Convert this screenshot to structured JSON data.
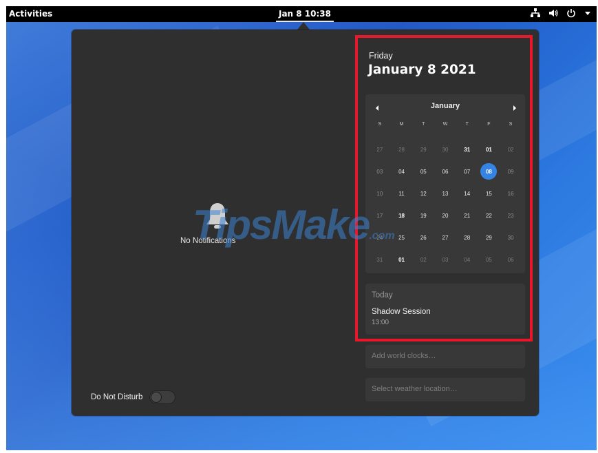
{
  "topbar": {
    "activities_label": "Activities",
    "clock_label": "Jan 8  10:38",
    "tray_icons": [
      "network-icon",
      "volume-icon",
      "power-icon",
      "menu-arrow-icon"
    ]
  },
  "notifications": {
    "empty_label": "No Notifications",
    "dnd_label": "Do Not Disturb",
    "dnd_enabled": false
  },
  "date": {
    "weekday": "Friday",
    "full_date": "January 8 2021"
  },
  "calendar": {
    "month_label": "January",
    "weekday_headers": [
      "S",
      "M",
      "T",
      "W",
      "T",
      "F",
      "S"
    ],
    "selected_day": "08",
    "weeks": [
      [
        {
          "d": "27",
          "c": "other"
        },
        {
          "d": "28",
          "c": "other"
        },
        {
          "d": "29",
          "c": "other"
        },
        {
          "d": "30",
          "c": "other"
        },
        {
          "d": "31",
          "c": "bold"
        },
        {
          "d": "01",
          "c": "bold"
        },
        {
          "d": "02",
          "c": "other"
        }
      ],
      [
        {
          "d": "03",
          "c": "weekend"
        },
        {
          "d": "04",
          "c": ""
        },
        {
          "d": "05",
          "c": ""
        },
        {
          "d": "06",
          "c": ""
        },
        {
          "d": "07",
          "c": ""
        },
        {
          "d": "08",
          "c": "selected"
        },
        {
          "d": "09",
          "c": "weekend"
        }
      ],
      [
        {
          "d": "10",
          "c": "weekend"
        },
        {
          "d": "11",
          "c": ""
        },
        {
          "d": "12",
          "c": ""
        },
        {
          "d": "13",
          "c": ""
        },
        {
          "d": "14",
          "c": ""
        },
        {
          "d": "15",
          "c": ""
        },
        {
          "d": "16",
          "c": "weekend"
        }
      ],
      [
        {
          "d": "17",
          "c": "weekend"
        },
        {
          "d": "18",
          "c": "bold"
        },
        {
          "d": "19",
          "c": ""
        },
        {
          "d": "20",
          "c": ""
        },
        {
          "d": "21",
          "c": ""
        },
        {
          "d": "22",
          "c": ""
        },
        {
          "d": "23",
          "c": "weekend"
        }
      ],
      [
        {
          "d": "24",
          "c": "weekend"
        },
        {
          "d": "25",
          "c": ""
        },
        {
          "d": "26",
          "c": ""
        },
        {
          "d": "27",
          "c": ""
        },
        {
          "d": "28",
          "c": ""
        },
        {
          "d": "29",
          "c": ""
        },
        {
          "d": "30",
          "c": "weekend"
        }
      ],
      [
        {
          "d": "31",
          "c": "other"
        },
        {
          "d": "01",
          "c": "bold"
        },
        {
          "d": "02",
          "c": "other"
        },
        {
          "d": "03",
          "c": "other"
        },
        {
          "d": "04",
          "c": "other"
        },
        {
          "d": "05",
          "c": "other"
        },
        {
          "d": "06",
          "c": "other"
        }
      ]
    ]
  },
  "events": {
    "section_title": "Today",
    "items": [
      {
        "title": "Shadow Session",
        "time": "13:00"
      }
    ]
  },
  "world_clocks": {
    "label": "Add world clocks…"
  },
  "weather": {
    "label": "Select weather location…"
  },
  "watermark": {
    "main": "TipsMake",
    "suffix": ".com"
  },
  "colors": {
    "accent": "#3584e4",
    "panel_bg": "#2f2f2f",
    "card_bg": "#383838",
    "highlight": "#e8172b"
  }
}
